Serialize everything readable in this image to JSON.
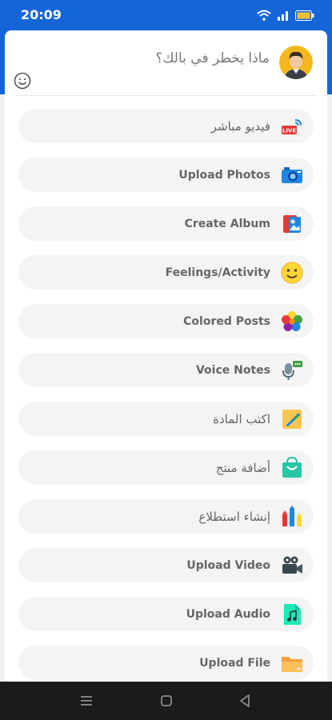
{
  "status_bar": {
    "time": "20:09"
  },
  "composer": {
    "placeholder": "ماذا يخطر في بالك؟"
  },
  "options": [
    {
      "label": "فيديو مباشر",
      "icon": "live-video-icon",
      "rtl": true
    },
    {
      "label": "Upload Photos",
      "icon": "camera-icon"
    },
    {
      "label": "Create Album",
      "icon": "album-icon"
    },
    {
      "label": "Feelings/Activity",
      "icon": "smiley-icon"
    },
    {
      "label": "Colored Posts",
      "icon": "color-flower-icon"
    },
    {
      "label": "Voice Notes",
      "icon": "microphone-icon"
    },
    {
      "label": "اكتب المادة",
      "icon": "write-article-icon",
      "rtl": true
    },
    {
      "label": "أضافة منتج",
      "icon": "shopping-bag-icon",
      "rtl": true
    },
    {
      "label": "إنشاء استطلاع",
      "icon": "poll-icon",
      "rtl": true
    },
    {
      "label": "Upload Video",
      "icon": "video-camera-icon"
    },
    {
      "label": "Upload Audio",
      "icon": "audio-file-icon"
    },
    {
      "label": "Upload File",
      "icon": "folder-icon"
    }
  ],
  "colors": {
    "brand": "#1565d8",
    "item_bg": "#f4f4f4"
  }
}
